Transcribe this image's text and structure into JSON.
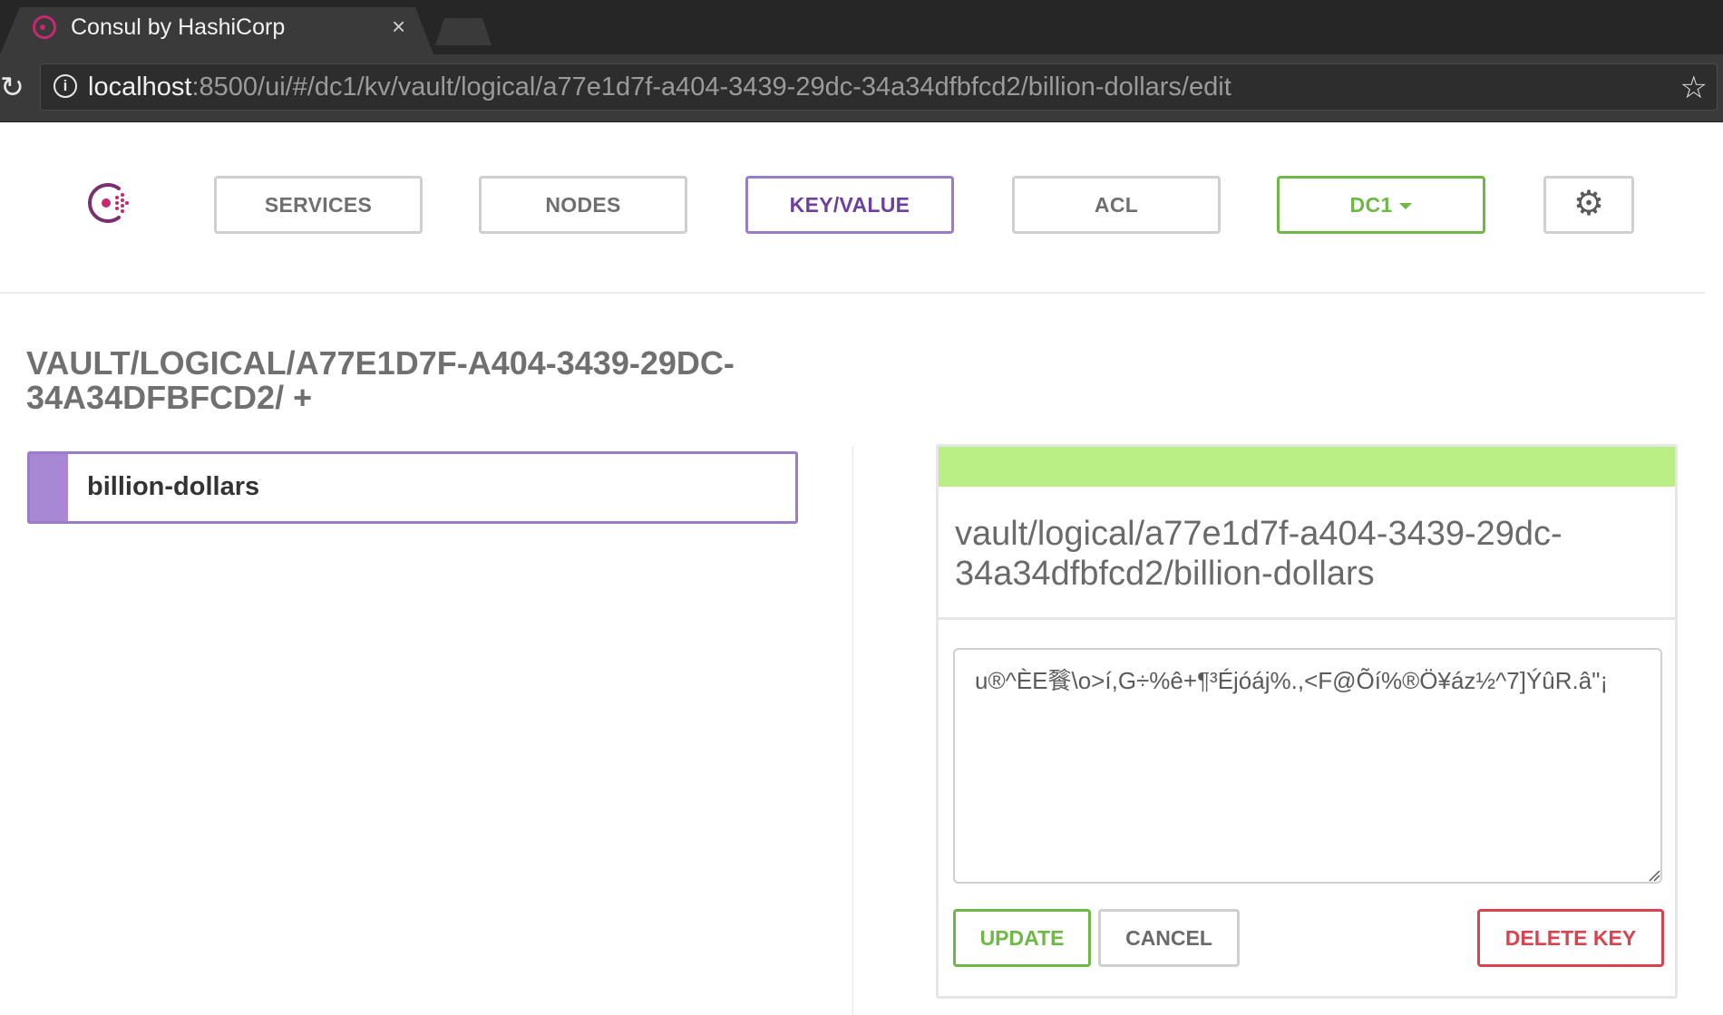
{
  "browser": {
    "tab_title": "Consul by HashiCorp",
    "tab_close": "×",
    "url_host": "localhost",
    "url_rest": ":8500/ui/#/dc1/kv/vault/logical/a77e1d7f-a404-3439-29dc-34a34dfbfcd2/billion-dollars/edit",
    "reload_glyph": "↻",
    "info_glyph": "i",
    "star_glyph": "☆"
  },
  "nav": {
    "services": "SERVICES",
    "nodes": "NODES",
    "kv": "KEY/VALUE",
    "acl": "ACL",
    "dc": "DC1",
    "gear_glyph": "⚙"
  },
  "content": {
    "path_title": "VAULT/LOGICAL/A77E1D7F-A404-3439-29DC-34A34DFBFCD2/ +",
    "keys": [
      {
        "label": "billion-dollars"
      }
    ]
  },
  "editor": {
    "title": "vault/logical/a77e1d7f-a404-3439-29dc-34a34dfbfcd2/billion-dollars",
    "value": "u®^ÈE餮\\o>í,G÷%ê+¶³Éjóáj%.,<F@Õí%®Ö¥áz½^7]ÝûR.â\"¡",
    "update_label": "UPDATE",
    "cancel_label": "CANCEL",
    "delete_label": "DELETE KEY"
  },
  "colors": {
    "consul_pink": "#c6296f",
    "kv_purple": "#9b7cc8",
    "dc_green": "#6eb845",
    "status_green": "#baef85",
    "delete_red": "#d9424e"
  }
}
